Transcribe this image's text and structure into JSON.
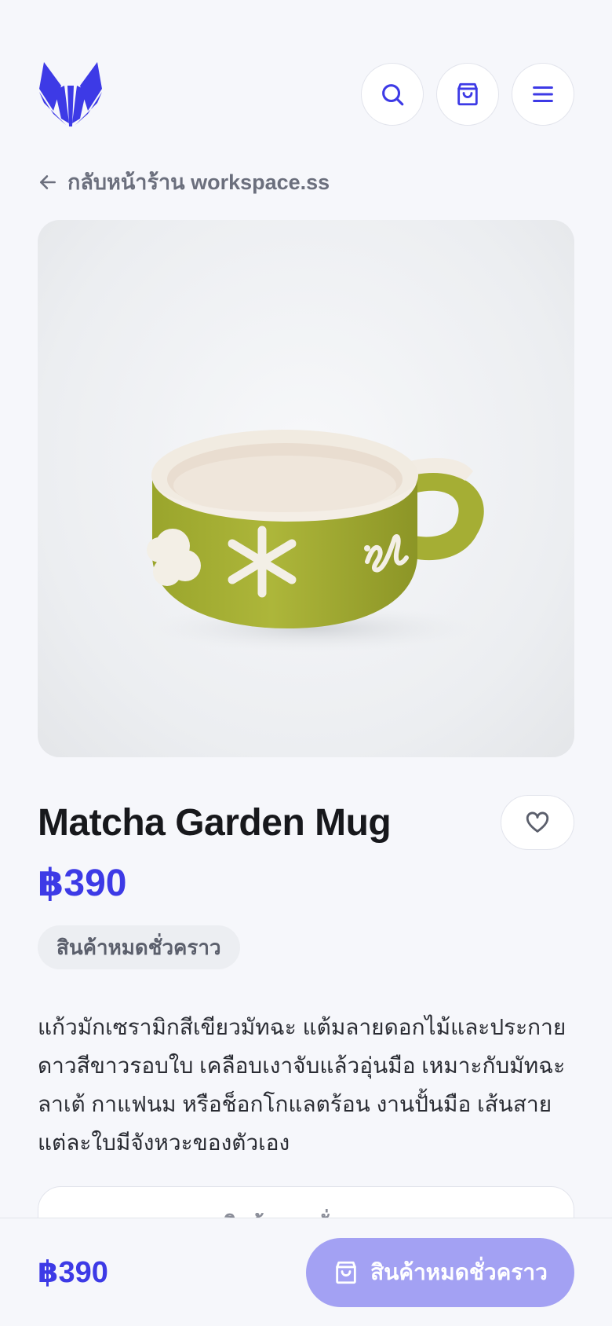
{
  "header": {
    "logo_name": "fox-logo",
    "actions": [
      {
        "name": "search-icon"
      },
      {
        "name": "shopping-bag-icon"
      },
      {
        "name": "menu-icon"
      }
    ]
  },
  "back_link": {
    "label": "กลับหน้าร้าน workspace.ss",
    "icon": "arrow-left-icon"
  },
  "product": {
    "title": "Matcha Garden Mug",
    "price": "฿390",
    "stock_status": "สินค้าหมดชั่วคราว",
    "description": "แก้วมักเซรามิกสีเขียวมัทฉะ แต้มลายดอกไม้และประกายดาวสีขาวรอบใบ เคลือบเงาจับแล้วอุ่นมือ เหมาะกับมัทฉะลาเต้ กาแฟนม หรือช็อกโกแลตร้อน งานปั้นมือ เส้นสายแต่ละใบมีจังหวะของตัวเอง",
    "wishlist_icon": "heart-icon"
  },
  "secondary_button": {
    "label": "สินค้าหมดชั่วคราว"
  },
  "bottom_bar": {
    "price": "฿390",
    "cta_label": "สินค้าหมดชั่วคราว",
    "cta_icon": "shopping-bag-icon"
  },
  "colors": {
    "accent": "#3d3ae6",
    "cta_disabled": "#a3a1f3",
    "background": "#f6f7fb"
  }
}
